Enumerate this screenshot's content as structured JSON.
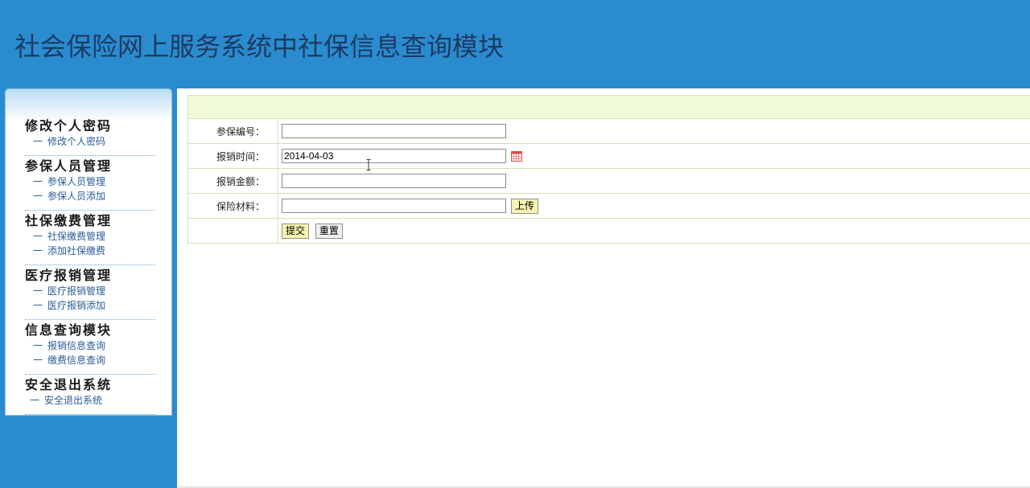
{
  "header": {
    "title": "社会保险网上服务系统中社保信息查询模块"
  },
  "sidebar": {
    "groups": [
      {
        "title": "修改个人密码",
        "items": [
          "修改个人密码"
        ]
      },
      {
        "title": "参保人员管理",
        "items": [
          "参保人员管理",
          "参保人员添加"
        ]
      },
      {
        "title": "社保缴费管理",
        "items": [
          "社保缴费管理",
          "添加社保缴费"
        ]
      },
      {
        "title": "医疗报销管理",
        "items": [
          "医疗报销管理",
          "医疗报销添加"
        ]
      },
      {
        "title": "信息查询模块",
        "items": [
          "报销信息查询",
          "缴费信息查询"
        ]
      },
      {
        "title": "安全退出系统",
        "items": [
          "安全退出系统"
        ]
      }
    ],
    "dash": "一"
  },
  "form": {
    "fields": {
      "insured_no": {
        "label": "参保编号：",
        "value": ""
      },
      "claim_date": {
        "label": "报销时间：",
        "value": "2014-04-03"
      },
      "claim_amount": {
        "label": "报销金额：",
        "value": ""
      },
      "material": {
        "label": "保险材料：",
        "value": ""
      }
    },
    "upload_label": "上传",
    "submit_label": "提交",
    "reset_label": "重置"
  },
  "colors": {
    "page_bg": "#2a8ccf",
    "title_text": "#1d3a63",
    "form_header_bg": "#f2fbd8",
    "button_bg": "#f7f4b0"
  },
  "icons": {
    "date_picker": "calendar-icon",
    "text_cursor": "ibeam-cursor-icon"
  }
}
